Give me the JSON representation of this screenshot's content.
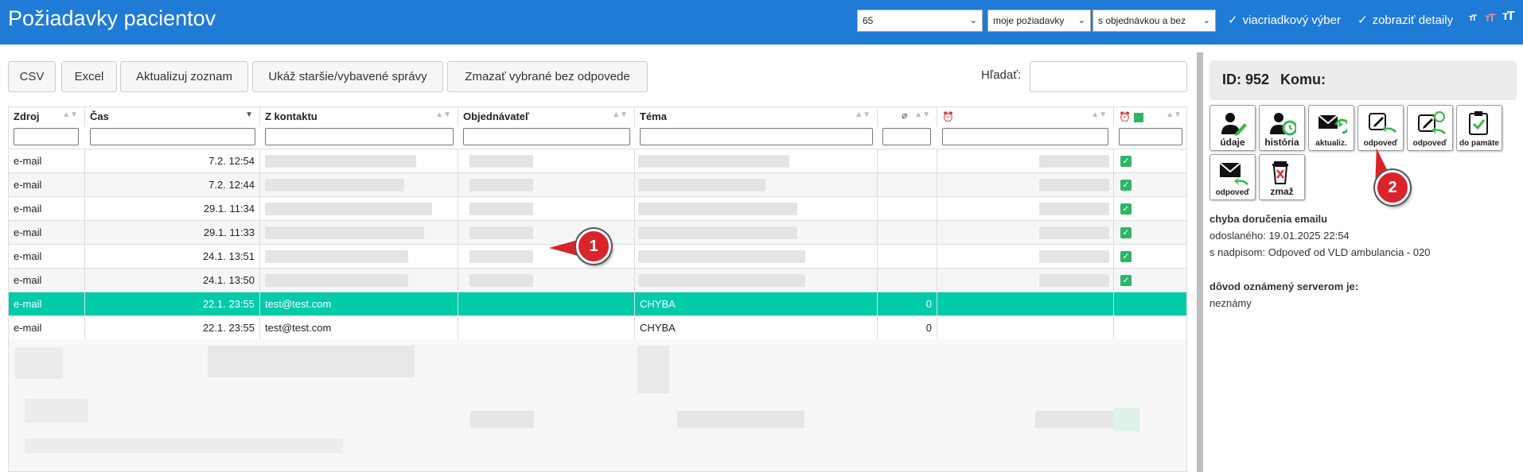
{
  "header": {
    "title": "Požiadavky pacientov",
    "select_count": "65",
    "select_scope": "moje požiadavky",
    "select_order": "s objednávkou a bez",
    "multi_row_label": "viacriadkový výber",
    "details_label": "zobraziť detaily",
    "check_mark": "✓",
    "font_icon": "тT"
  },
  "toolbar": {
    "csv": "CSV",
    "excel": "Excel",
    "refresh": "Aktualizuj zoznam",
    "show_older": "Ukáž staršie/vybavené správy",
    "delete_unanswered": "Zmazať vybrané bez odpovede",
    "search_label": "Hľadať:"
  },
  "table": {
    "columns": [
      "Zdroj",
      "Čas",
      "Z kontaktu",
      "Objednávateľ",
      "Téma",
      "",
      "",
      ""
    ],
    "rows": [
      {
        "source": "e-mail",
        "time": "7.2. 12:54",
        "contact": "",
        "orderer": "",
        "topic": "",
        "count": "",
        "done": true
      },
      {
        "source": "e-mail",
        "time": "7.2. 12:44",
        "contact": "",
        "orderer": "",
        "topic": "",
        "count": "",
        "done": true
      },
      {
        "source": "e-mail",
        "time": "29.1. 11:34",
        "contact": "",
        "orderer": "",
        "topic": "",
        "count": "",
        "done": true
      },
      {
        "source": "e-mail",
        "time": "29.1. 11:33",
        "contact": "",
        "orderer": "",
        "topic": "",
        "count": "",
        "done": true
      },
      {
        "source": "e-mail",
        "time": "24.1. 13:51",
        "contact": "",
        "orderer": "",
        "topic": "",
        "count": "",
        "done": true
      },
      {
        "source": "e-mail",
        "time": "24.1. 13:50",
        "contact": "",
        "orderer": "",
        "topic": "",
        "count": "",
        "done": true
      },
      {
        "source": "e-mail",
        "time": "22.1. 23:55",
        "contact": "test@test.com",
        "orderer": "",
        "topic": "CHYBA",
        "count": "0",
        "done": false
      },
      {
        "source": "e-mail",
        "time": "22.1. 23:55",
        "contact": "test@test.com",
        "orderer": "",
        "topic": "CHYBA",
        "count": "0",
        "done": false
      }
    ]
  },
  "callouts": {
    "one": "1",
    "two": "2"
  },
  "panel": {
    "id_label": "ID: 952",
    "to_label": "Komu:",
    "actions": [
      "údaje",
      "história",
      "aktualiz.",
      "odpoveď",
      "odpoveď",
      "do pamäte",
      "odpoveď",
      "zmaž"
    ],
    "error_title": "chyba doručenia emailu",
    "sent_line": "odoslaného: 19.01.2025 22:54",
    "subject_line": "s nadpisom: Odpoveď od VLD ambulancia - 020",
    "reason_title": "dôvod oznámený serverom je:",
    "reason_value": "neznámy"
  },
  "colors": {
    "topbar": "#1f7bd6",
    "selected_row": "#00cca9",
    "callout": "#d8242a",
    "check": "#2db56a"
  }
}
